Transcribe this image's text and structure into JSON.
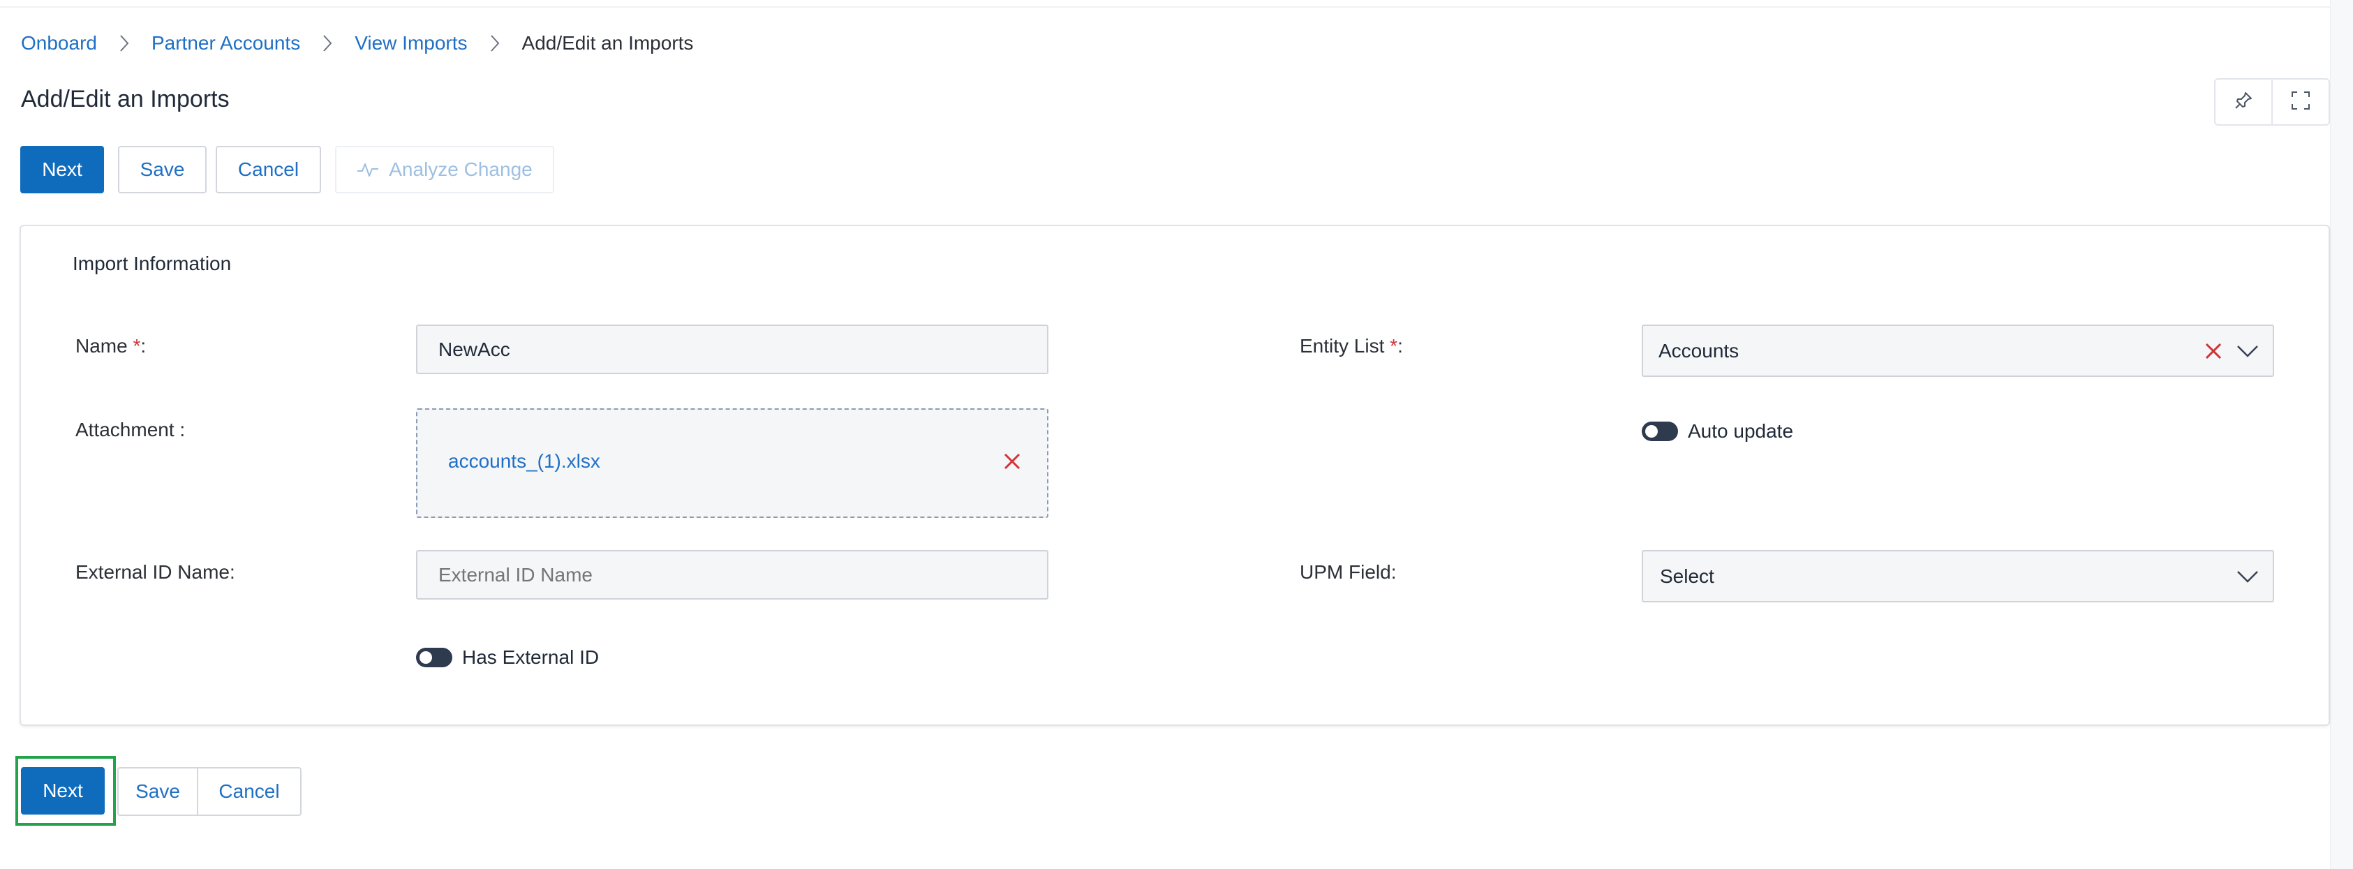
{
  "breadcrumb": {
    "items": [
      "Onboard",
      "Partner Accounts",
      "View Imports"
    ],
    "current": "Add/Edit an Imports"
  },
  "page": {
    "title": "Add/Edit an Imports"
  },
  "toolbar": {
    "next_label": "Next",
    "save_label": "Save",
    "cancel_label": "Cancel",
    "analyze_label": "Analyze Change"
  },
  "form": {
    "section_title": "Import Information",
    "name": {
      "label": "Name",
      "value": "NewAcc"
    },
    "attachment": {
      "label": "Attachment :",
      "file_name": "accounts_(1).xlsx"
    },
    "external_id_name": {
      "label": "External ID Name:",
      "placeholder": "External ID Name",
      "value": ""
    },
    "has_external_id": {
      "label": "Has External ID",
      "on": false
    },
    "entity_list": {
      "label": "Entity List",
      "value": "Accounts"
    },
    "auto_update": {
      "label": "Auto update",
      "on": false
    },
    "upm_field": {
      "label": "UPM Field:",
      "value": "Select"
    },
    "required_mark": "*",
    "label_colon": ":"
  },
  "footer": {
    "next_label": "Next",
    "save_label": "Save",
    "cancel_label": "Cancel"
  },
  "icons": {
    "breadcrumb_separator": "chevron-right-icon",
    "pin": "pin-icon",
    "fullscreen": "fullscreen-icon",
    "analyze": "pulse-icon",
    "clear": "close-icon",
    "dropdown": "chevron-down-icon"
  },
  "colors": {
    "primary": "#0f6cbd",
    "link": "#1f6fc5",
    "required": "#d13438",
    "highlight": "#22a34a"
  }
}
